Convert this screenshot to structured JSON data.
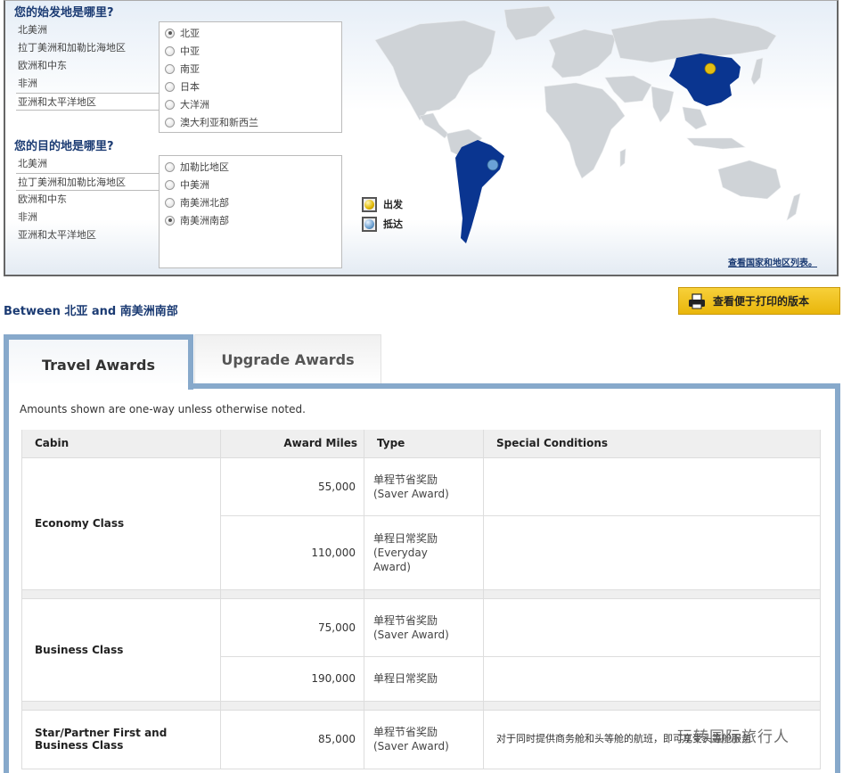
{
  "selector": {
    "origin_question": "您的始发地是哪里?",
    "origin_regions": [
      "北美洲",
      "拉丁美洲和加勒比海地区",
      "欧洲和中东",
      "非洲",
      "亚洲和太平洋地区"
    ],
    "origin_active_region": 4,
    "origin_subregions": [
      {
        "label": "北亚",
        "checked": true
      },
      {
        "label": "中亚",
        "checked": false
      },
      {
        "label": "南亚",
        "checked": false
      },
      {
        "label": "日本",
        "checked": false
      },
      {
        "label": "大洋洲",
        "checked": false
      },
      {
        "label": "澳大利亚和新西兰",
        "checked": false
      }
    ],
    "destination_question": "您的目的地是哪里?",
    "destination_regions": [
      "北美洲",
      "拉丁美洲和加勒比海地区",
      "欧洲和中东",
      "非洲",
      "亚洲和太平洋地区"
    ],
    "destination_active_region": 1,
    "destination_subregions": [
      {
        "label": "加勒比地区",
        "checked": false
      },
      {
        "label": "中美洲",
        "checked": false
      },
      {
        "label": "南美洲北部",
        "checked": false
      },
      {
        "label": "南美洲南部",
        "checked": true
      }
    ]
  },
  "map": {
    "legend_departure": "出发",
    "legend_arrival": "抵达",
    "country_list_link": "查看国家和地区列表。",
    "highlight_color": "#0a3590",
    "land_color": "#cfd3d7"
  },
  "route": {
    "between_label": "Between 北亚 and 南美洲南部"
  },
  "print_button": "查看便于打印的版本",
  "tabs": [
    {
      "label": "Travel Awards",
      "active": true
    },
    {
      "label": "Upgrade Awards",
      "active": false
    }
  ],
  "note": "Amounts shown are one-way unless otherwise noted.",
  "table": {
    "headers": [
      "Cabin",
      "Award Miles",
      "Type",
      "Special Conditions"
    ],
    "groups": [
      {
        "cabin": "Economy Class",
        "rows": [
          {
            "miles": "55,000",
            "type_cn": "单程节省奖励",
            "type_en": "(Saver Award)",
            "conditions": ""
          },
          {
            "miles": "110,000",
            "type_cn": "单程日常奖励",
            "type_en": "(Everyday Award)",
            "conditions": ""
          }
        ]
      },
      {
        "cabin": "Business Class",
        "rows": [
          {
            "miles": "75,000",
            "type_cn": "单程节省奖励",
            "type_en": "(Saver Award)",
            "conditions": ""
          },
          {
            "miles": "190,000",
            "type_cn": "单程日常奖励",
            "type_en": "",
            "conditions": ""
          }
        ]
      },
      {
        "cabin": "Star/Partner First and Business Class",
        "rows": [
          {
            "miles": "85,000",
            "type_cn": "单程节省奖励",
            "type_en": "(Saver Award)",
            "conditions": "对于同时提供商务舱和头等舱的航班，即可享受头等舱服务"
          }
        ]
      }
    ]
  },
  "watermark": "玩转国际旅行人"
}
